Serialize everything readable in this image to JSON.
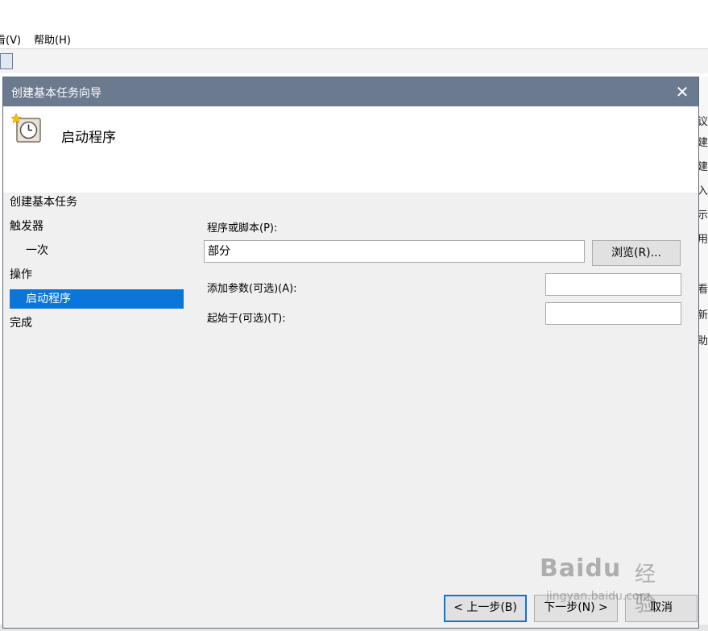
{
  "background_app": {
    "menus": [
      "看(V)",
      "帮助(H)"
    ],
    "right_glyphs": [
      "议",
      "建",
      "建",
      "入",
      "示",
      "用",
      "看",
      "新",
      "助"
    ]
  },
  "dialog": {
    "title": "创建基本任务向导",
    "close_symbol": "✕",
    "header_title": "启动程序",
    "steps": [
      {
        "label": "创建基本任务"
      },
      {
        "label": "触发器"
      },
      {
        "label": "一次"
      },
      {
        "label": "操作"
      },
      {
        "label": "启动程序"
      },
      {
        "label": "完成"
      }
    ],
    "program_label": "程序或脚本(P):",
    "program_value": "部分",
    "browse_label": "浏览(R)...",
    "args_label": "添加参数(可选)(A):",
    "args_value": "",
    "startin_label": "起始于(可选)(T):",
    "startin_value": "",
    "back_label": "< 上一步(B)",
    "next_label": "下一步(N) >",
    "cancel_label": "取消",
    "accent_color": "#0a76d8"
  },
  "watermark": {
    "logo": "Baidu",
    "suffix": "经验",
    "url": "jingyan.baidu.com"
  }
}
